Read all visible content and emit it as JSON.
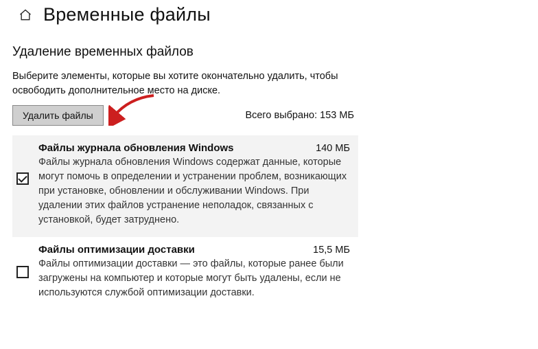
{
  "header": {
    "title": "Временные файлы"
  },
  "subheading": "Удаление временных файлов",
  "instructions": "Выберите элементы, которые вы хотите окончательно удалить, чтобы освободить дополнительное место на диске.",
  "deleteButton": "Удалить файлы",
  "totalSelected": "Всего выбрано: 153 МБ",
  "items": [
    {
      "title": "Файлы журнала обновления Windows",
      "size": "140 МБ",
      "desc": "Файлы журнала обновления Windows содержат данные, которые могут помочь в определении и устранении проблем, возникающих при установке, обновлении и обслуживании Windows. При удалении этих файлов устранение неполадок, связанных с установкой, будет затруднено.",
      "checked": true
    },
    {
      "title": "Файлы оптимизации доставки",
      "size": "15,5 МБ",
      "desc": "Файлы оптимизации доставки — это файлы, которые ранее были загружены на компьютер и которые могут быть удалены, если не используются службой оптимизации доставки.",
      "checked": false
    }
  ]
}
